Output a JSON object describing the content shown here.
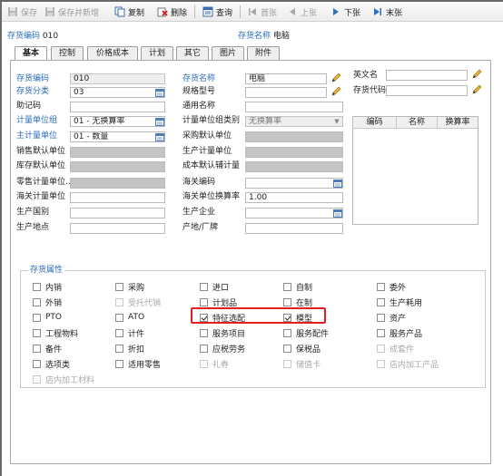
{
  "toolbar": {
    "save": "保存",
    "save_new": "保存并新增",
    "copy": "复制",
    "delete": "删除",
    "query": "查询",
    "first": "首张",
    "prev": "上张",
    "next": "下张",
    "last": "末张"
  },
  "header": {
    "code_label": "存货编码",
    "code_value": "010",
    "name_label": "存货名称",
    "name_value": "电脑"
  },
  "tabs": [
    "基本",
    "控制",
    "价格成本",
    "计划",
    "其它",
    "图片",
    "附件"
  ],
  "form": {
    "code_label": "存货编码",
    "code_value": "010",
    "class_label": "存货分类",
    "class_value": "03",
    "mnemonic_label": "助记码",
    "mnemonic_value": "",
    "uomgroup_label": "计量单位组",
    "uomgroup_value": "01 - 无换算率",
    "mainuom_label": "主计量单位",
    "mainuom_value": "01 - 数量",
    "saleuom_label": "销售默认单位",
    "stockuom_label": "库存默认单位",
    "retailuom_label": "零售计量单位...",
    "customsuom_label": "海关计量单位",
    "origin_label": "生产国别",
    "place_label": "生产地点",
    "name_label": "存货名称",
    "name_value": "电脑",
    "spec_label": "规格型号",
    "common_label": "通用名称",
    "uomgroup_cat_label": "计量单位组类别",
    "uomgroup_cat_value": "无换算率",
    "purchuom_label": "采购默认单位",
    "produom_label": "生产计量单位",
    "costuom_label": "成本默认辅计量",
    "customs_code_label": "海关编码",
    "customs_rate_label": "海关单位换算率",
    "customs_rate_value": "1.00",
    "manufacturer_label": "生产企业",
    "origin_brand_label": "产地/厂牌",
    "english_label": "英文名",
    "inv_code_label": "存货代码"
  },
  "mini_table": {
    "columns": [
      "编码",
      "名称",
      "换算率"
    ]
  },
  "attributes": {
    "title": "存货属性",
    "items": [
      {
        "key": "domestic_sale",
        "label": "内销",
        "checked": false,
        "disabled": false
      },
      {
        "key": "purchase",
        "label": "采购",
        "checked": false,
        "disabled": false
      },
      {
        "key": "import",
        "label": "进口",
        "checked": false,
        "disabled": false
      },
      {
        "key": "self_made",
        "label": "自制",
        "checked": false,
        "disabled": false
      },
      {
        "key": "outsource",
        "label": "委外",
        "checked": false,
        "disabled": false
      },
      {
        "key": "export_sale",
        "label": "外销",
        "checked": false,
        "disabled": false
      },
      {
        "key": "consign_agent",
        "label": "受托代销",
        "checked": false,
        "disabled": true
      },
      {
        "key": "plan_item",
        "label": "计划品",
        "checked": false,
        "disabled": false
      },
      {
        "key": "wip",
        "label": "在制",
        "checked": false,
        "disabled": false
      },
      {
        "key": "prod_consume",
        "label": "生产耗用",
        "checked": false,
        "disabled": false
      },
      {
        "key": "pto",
        "label": "PTO",
        "checked": false,
        "disabled": false
      },
      {
        "key": "ato",
        "label": "ATO",
        "checked": false,
        "disabled": false
      },
      {
        "key": "feature_config",
        "label": "特征选配",
        "checked": true,
        "disabled": false
      },
      {
        "key": "model",
        "label": "模型",
        "checked": true,
        "disabled": false
      },
      {
        "key": "asset",
        "label": "资产",
        "checked": false,
        "disabled": false
      },
      {
        "key": "eng_material",
        "label": "工程物料",
        "checked": false,
        "disabled": false
      },
      {
        "key": "piece",
        "label": "计件",
        "checked": false,
        "disabled": false
      },
      {
        "key": "service_item",
        "label": "服务项目",
        "checked": false,
        "disabled": false
      },
      {
        "key": "service_part",
        "label": "服务配件",
        "checked": false,
        "disabled": false
      },
      {
        "key": "service_product",
        "label": "服务产品",
        "checked": false,
        "disabled": false
      },
      {
        "key": "spare_part",
        "label": "备件",
        "checked": false,
        "disabled": false
      },
      {
        "key": "discount",
        "label": "折扣",
        "checked": false,
        "disabled": false
      },
      {
        "key": "receivable_service",
        "label": "应税劳务",
        "checked": false,
        "disabled": false
      },
      {
        "key": "bonded",
        "label": "保税品",
        "checked": false,
        "disabled": false
      },
      {
        "key": "kit",
        "label": "成套件",
        "checked": false,
        "disabled": true
      },
      {
        "key": "optional",
        "label": "选项类",
        "checked": false,
        "disabled": false
      },
      {
        "key": "retail",
        "label": "适用零售",
        "checked": false,
        "disabled": false
      },
      {
        "key": "gift",
        "label": "礼券",
        "checked": false,
        "disabled": true
      },
      {
        "key": "stored_card",
        "label": "储值卡",
        "checked": false,
        "disabled": true
      },
      {
        "key": "inhouse_product",
        "label": "店内加工产品",
        "checked": false,
        "disabled": true
      },
      {
        "key": "inhouse_material",
        "label": "店内加工材料",
        "checked": false,
        "disabled": true
      }
    ]
  },
  "colors": {
    "label_blue": "#2b6cb8",
    "highlight_red": "#e02020"
  }
}
